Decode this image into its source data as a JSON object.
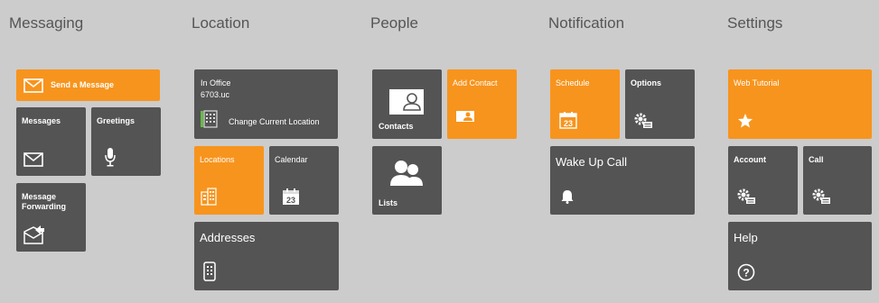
{
  "columns": {
    "messaging": "Messaging",
    "location": "Location",
    "people": "People",
    "notification": "Notification",
    "settings": "Settings"
  },
  "messaging": {
    "send_message": "Send a Message",
    "messages": "Messages",
    "greetings": "Greetings",
    "message_forwarding": "Message Forwarding"
  },
  "location": {
    "status_line1": "In Office",
    "status_line2": "6703.uc",
    "change_location": "Change Current Location",
    "locations": "Locations",
    "calendar": "Calendar",
    "calendar_day": "23",
    "addresses": "Addresses"
  },
  "people": {
    "contacts": "Contacts",
    "add_contact": "Add Contact",
    "lists": "Lists"
  },
  "notification": {
    "schedule": "Schedule",
    "schedule_day": "23",
    "options": "Options",
    "wake_up_call": "Wake Up Call"
  },
  "settings": {
    "web_tutorial": "Web Tutorial",
    "account": "Account",
    "call": "Call",
    "help": "Help"
  },
  "colors": {
    "background": "#cccccc",
    "tile_dark": "#545454",
    "tile_accent": "#f7941d",
    "heading": "#555555"
  }
}
